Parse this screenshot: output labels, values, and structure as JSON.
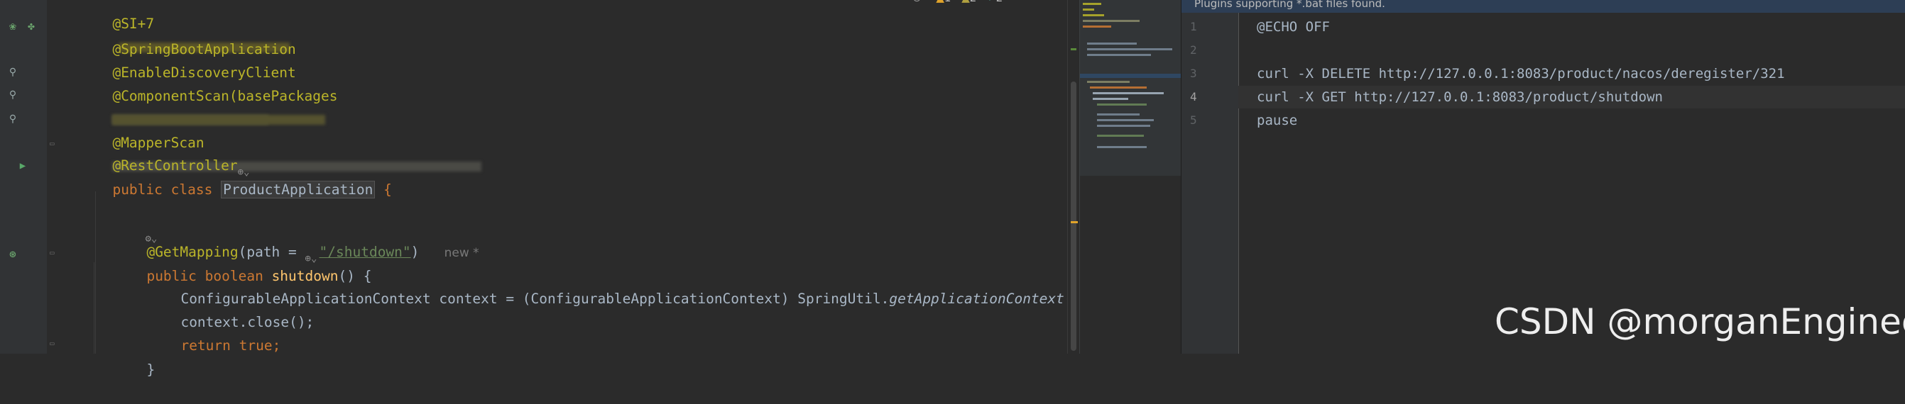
{
  "editor": {
    "lines": {
      "l1": "@SpringBootApplication",
      "l2": "@EnableDiscoveryClient",
      "l3": "@ComponentScan(basePackages",
      "l4": "@MapperScan",
      "l5_annotation": "@RestController",
      "l6_kw": "public class ",
      "l6_class": "ProductApplication",
      "l6_brace": " {",
      "l8_annotation": "@GetMapping",
      "l8_param": "(path = ",
      "l8_value": "\"/shutdown\"",
      "l8_close": ")",
      "l8_hint": "new *",
      "l9_kw": "public boolean ",
      "l9_method": "shutdown",
      "l9_rest": "() {",
      "l10_a": "ConfigurableApplicationContext context = (ConfigurableApplicationContext) SpringUtil.",
      "l10_method": "getApplicationContext",
      "l10_b": "();",
      "l11": "context.close();",
      "l12_kw": "return true",
      "l12_semi": ";",
      "l13": "}"
    },
    "top_fragments": {
      "a": "@SI+7",
      "b": "@S",
      "c": "ringB"
    }
  },
  "warnings": {
    "warn_count": "1",
    "weak_count": "2",
    "typo_count": "2"
  },
  "right_pane": {
    "banner": "Plugins supporting *.bat files found.",
    "line_numbers": [
      "1",
      "2",
      "3",
      "4",
      "5"
    ],
    "lines": [
      "@ECHO OFF",
      "",
      "curl -X DELETE http://127.0.0.1:8083/product/nacos/deregister/321",
      "curl -X GET http://127.0.0.1:8083/product/shutdown",
      "pause"
    ],
    "current_line": 4
  },
  "watermark": "CSDN @morganEngineer",
  "colors": {
    "background": "#2b2b2b",
    "annotation": "#bbb529",
    "keyword": "#cc7832",
    "string": "#6a8759",
    "method": "#ffc66d",
    "text": "#a9b7c6"
  }
}
